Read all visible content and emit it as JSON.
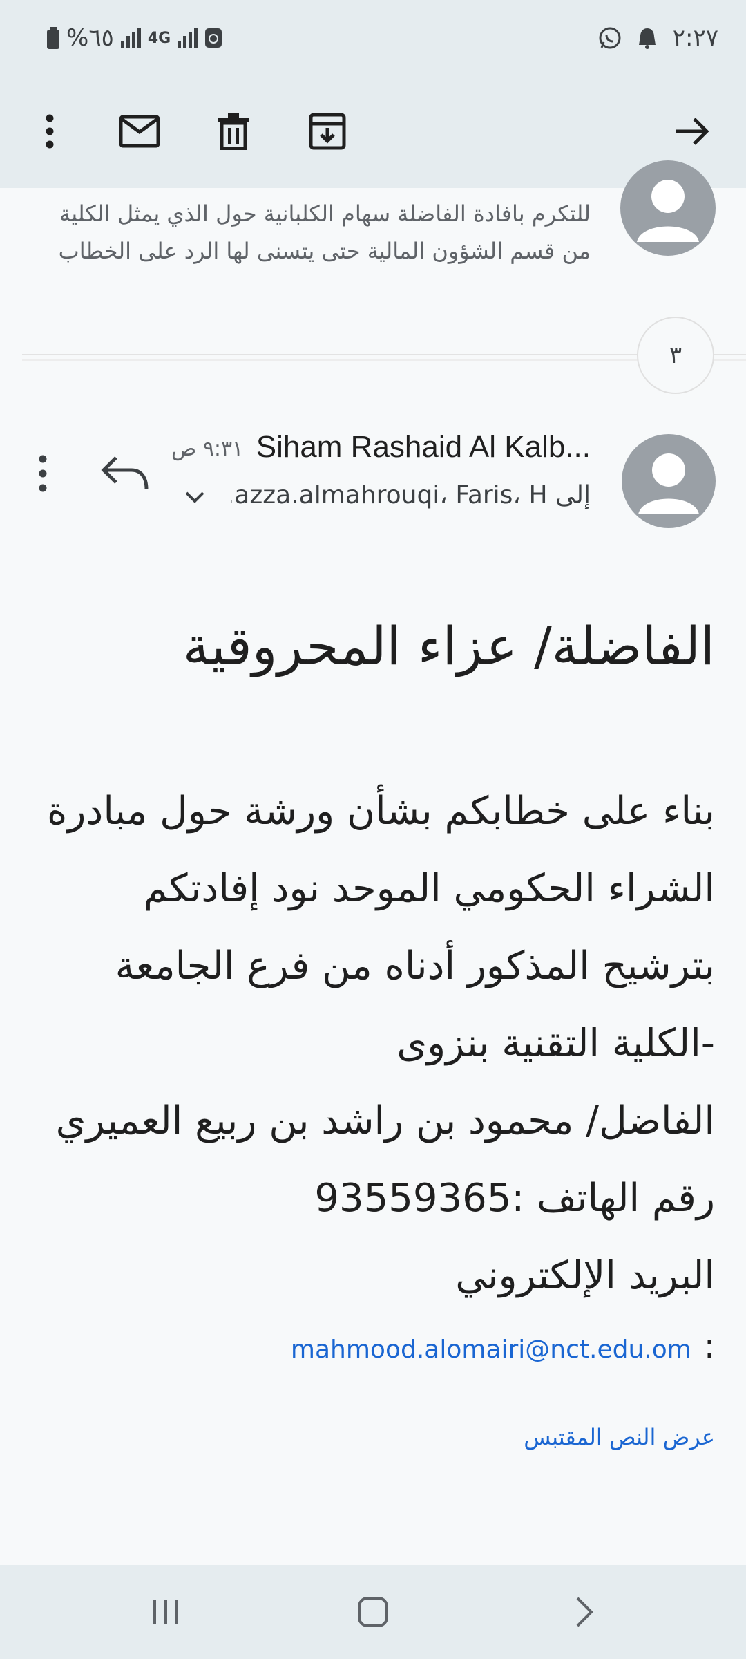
{
  "status_bar": {
    "battery": "%٦٥",
    "network": "4G",
    "clock": "٢:٢٧"
  },
  "toolbar": {
    "more": "more-vert-icon",
    "mark_unread": "mail-icon",
    "delete": "delete-icon",
    "archive": "archive-icon",
    "back": "arrow-forward-icon"
  },
  "previous_message": {
    "preview_lines": [
      "للتكرم بافادة الفاضلة سهام الكلبانية حول الذي يمثل الكلية",
      "من قسم الشؤون المالية حتى يتسنى لها الرد على الخطاب"
    ]
  },
  "collapsed_count": "٣",
  "message": {
    "sender": "Siham Rashaid Al Kalb...",
    "time": "٩:٣١ ص",
    "recipients": "إلى azza.almahrouqi، Faris، H..."
  },
  "body": {
    "title": "الفاضلة/ عزاء المحروقية",
    "lines": [
      "بناء على خطابكم بشأن  ورشة حول مبادرة",
      "الشراء الحكومي الموحد نود إفادتكم",
      "بترشيح المذكور أدناه من فرع الجامعة",
      "-الكلية التقنية بنزوى",
      "الفاضل/ محمود بن راشد بن ربيع العميري",
      "رقم الهاتف :93559365",
      "البريد الإلكتروني"
    ],
    "email_colon": ":",
    "email": "mahmood.alomairi@nct.edu.om",
    "show_quoted": "عرض النص المقتبس"
  },
  "colors": {
    "bar_bg": "#e5ecef",
    "page_bg": "#f7f9fa",
    "link": "#1a66d2",
    "avatar": "#9aa0a6"
  }
}
